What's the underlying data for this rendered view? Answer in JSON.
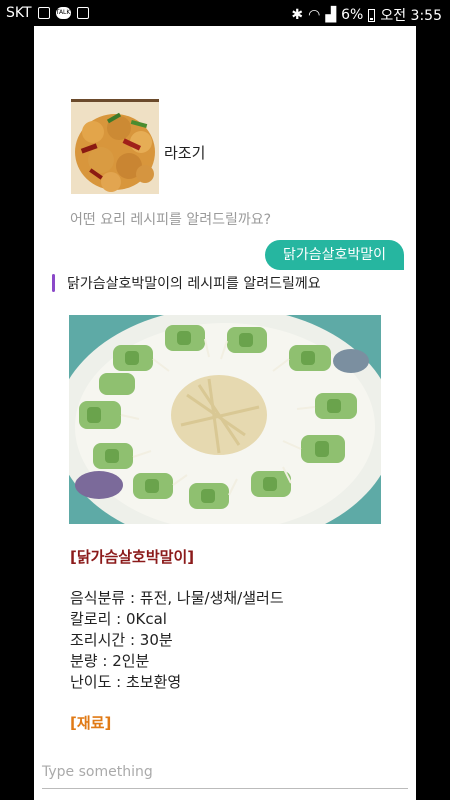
{
  "status_bar": {
    "carrier": "SKT",
    "battery": "6%",
    "time": "오전 3:55"
  },
  "bot": {
    "name": "라조기",
    "greeting": "어떤 요리 레시피를 알려드릴까요?"
  },
  "conversation": {
    "user_message": "닭가슴살호박말이",
    "bot_reply": "닭가슴살호박말이의 레시피를 알려드릴께요"
  },
  "recipe": {
    "title": "[닭가슴살호박말이]",
    "category": "음식분류 : 퓨전, 나물/생채/샐러드",
    "calories": "칼로리 : 0Kcal",
    "cook_time": "조리시간 : 30분",
    "servings": "분량 : 2인분",
    "difficulty": "난이도 : 초보환영",
    "ingredients_heading": "[재료]"
  },
  "input": {
    "placeholder": "Type something"
  },
  "colors": {
    "user_bubble": "#26b6a0",
    "bot_indicator": "#8b49c9",
    "recipe_title": "#8b1a1a",
    "ingredients_heading": "#e07a16"
  }
}
